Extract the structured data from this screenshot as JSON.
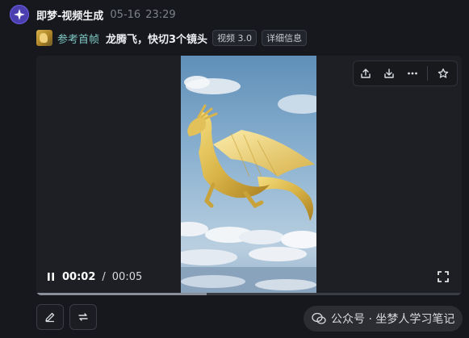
{
  "message": {
    "app_name": "即梦-视频生成",
    "date": "05-16",
    "time": "23:29"
  },
  "prompt": {
    "ref_label": "参考首帧",
    "text": "龙腾飞，快切3个镜头",
    "tags": [
      "视频 3.0",
      "详细信息"
    ]
  },
  "player": {
    "current_time": "00:02",
    "separator": "/",
    "duration": "00:05",
    "progress": 0.4,
    "toolbar_icons": [
      "share-icon",
      "download-icon",
      "more-icon",
      "star-icon"
    ]
  },
  "actions": [
    "edit-icon",
    "regenerate-icon"
  ],
  "watermark": {
    "text": "公众号 · 坐梦人学习笔记"
  },
  "colors": {
    "background": "#16181d",
    "avatar": "#4b3fb0",
    "ref_label": "#7fc7c4"
  }
}
